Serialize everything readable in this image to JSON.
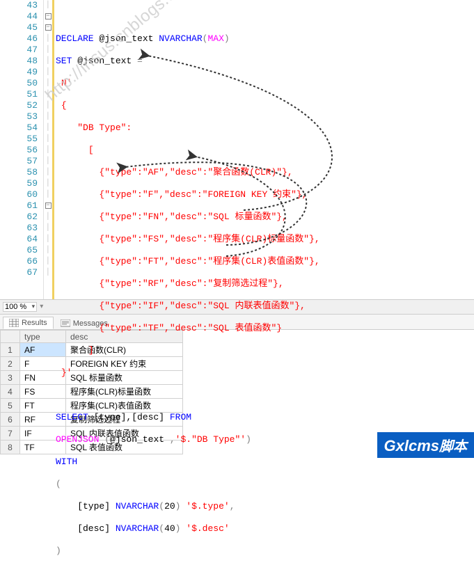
{
  "zoom": "100 %",
  "tabs": {
    "results": "Results",
    "messages": "Messages"
  },
  "grid": {
    "headers": {
      "type": "type",
      "desc": "desc"
    },
    "rows": [
      {
        "n": "1",
        "type": "AF",
        "desc": "聚合函数(CLR)"
      },
      {
        "n": "2",
        "type": "F",
        "desc": "FOREIGN KEY 约束"
      },
      {
        "n": "3",
        "type": "FN",
        "desc": "SQL 标量函数"
      },
      {
        "n": "4",
        "type": "FS",
        "desc": "程序集(CLR)标量函数"
      },
      {
        "n": "5",
        "type": "FT",
        "desc": "程序集(CLR)表值函数"
      },
      {
        "n": "6",
        "type": "RF",
        "desc": "复制筛选过程"
      },
      {
        "n": "7",
        "type": "IF",
        "desc": "SQL 内联表值函数"
      },
      {
        "n": "8",
        "type": "TF",
        "desc": "SQL 表值函数"
      }
    ]
  },
  "lines": {
    "start": 43,
    "end": 67
  },
  "code": {
    "l44": {
      "kw1": "DECLARE",
      "var": " @json_text ",
      "type": "NVARCHAR",
      "p1": "(",
      "max": "MAX",
      "p2": ")"
    },
    "l45": {
      "kw1": "SET",
      "var": " @json_text ",
      "eq": "="
    },
    "l46": "N'",
    "l47": "{",
    "l48": "\"DB Type\":",
    "l49": "[",
    "l50": "{\"type\":\"AF\",\"desc\":\"聚合函数(CLR)\"},",
    "l51": "{\"type\":\"F\",\"desc\":\"FOREIGN KEY 约束\"},",
    "l52": "{\"type\":\"FN\",\"desc\":\"SQL 标量函数\"},",
    "l53": "{\"type\":\"FS\",\"desc\":\"程序集(CLR)标量函数\"},",
    "l54": "{\"type\":\"FT\",\"desc\":\"程序集(CLR)表值函数\"},",
    "l55": "{\"type\":\"RF\",\"desc\":\"复制筛选过程\"},",
    "l56": "{\"type\":\"IF\",\"desc\":\"SQL 内联表值函数\"},",
    "l57": "{\"type\":\"TF\",\"desc\":\"SQL 表值函数\"}",
    "l58": "]",
    "l59": "}'",
    "l61": {
      "kw1": "SELECT",
      "cols": " [type],[desc] ",
      "kw2": "FROM"
    },
    "l62": {
      "fn": "OPENJSON",
      "p1": " (",
      "var": "@json_text ",
      "c": ",",
      "path": "'$.\"DB Type\"'",
      "p2": ")"
    },
    "l63": "WITH",
    "l64": "(",
    "l65": {
      "col": "    [type] ",
      "type": "NVARCHAR",
      "p1": "(",
      "n": "20",
      "p2": ") ",
      "path": "'$.type'",
      "c": ","
    },
    "l66": {
      "col": "    [desc] ",
      "type": "NVARCHAR",
      "p1": "(",
      "n": "40",
      "p2": ") ",
      "path": "'$.desc'"
    },
    "l67": ")"
  },
  "watermark": "http://insus.cnblogs.com",
  "badge": {
    "a": "Gxlcms",
    "b": "脚本"
  }
}
